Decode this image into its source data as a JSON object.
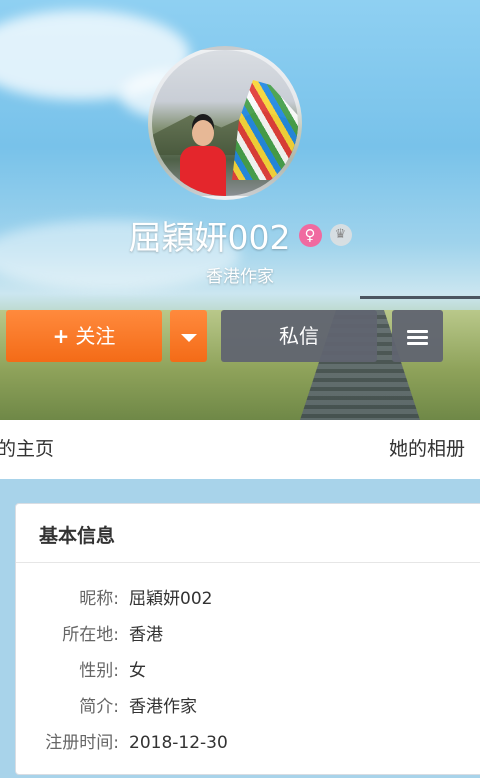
{
  "profile": {
    "name": "屈穎妍002",
    "subtitle": "香港作家",
    "gender_symbol": "♀"
  },
  "actions": {
    "follow_label": "关注",
    "follow_plus": "+",
    "message_label": "私信"
  },
  "tabs": {
    "home": "的主页",
    "album": "她的相册"
  },
  "info": {
    "title": "基本信息",
    "rows": [
      {
        "label": "昵称:",
        "value": "屈穎妍002"
      },
      {
        "label": "所在地:",
        "value": "香港"
      },
      {
        "label": "性别:",
        "value": "女"
      },
      {
        "label": "简介:",
        "value": "香港作家"
      },
      {
        "label": "注册时间:",
        "value": "2018-12-30"
      }
    ]
  },
  "colors": {
    "accent_orange": "#f46b17",
    "button_gray": "#606470",
    "female_pink": "#f06aa0",
    "page_bg": "#a8d3ea"
  },
  "icons": [
    "female-icon",
    "crown-icon",
    "plus-icon",
    "caret-down-icon",
    "menu-icon"
  ]
}
